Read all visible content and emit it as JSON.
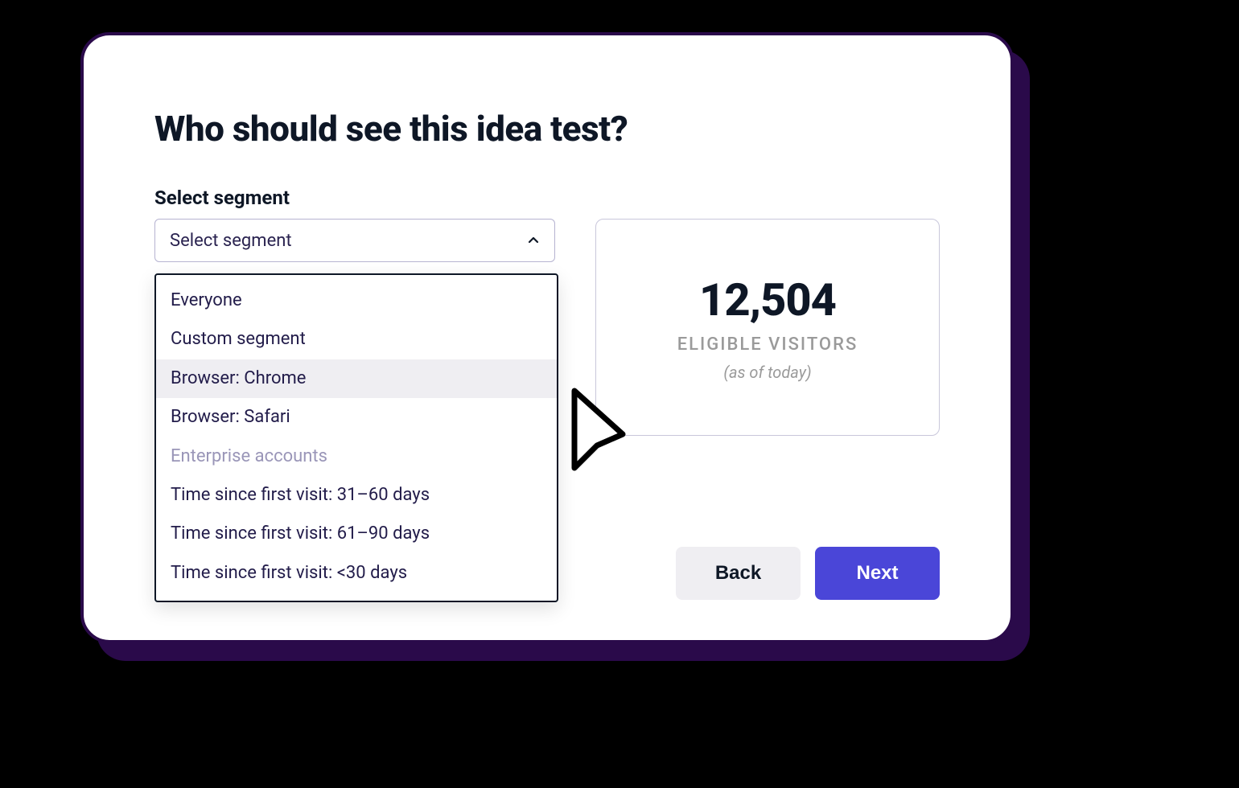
{
  "title": "Who should see this idea test?",
  "segment": {
    "label": "Select segment",
    "placeholder": "Select segment",
    "options": [
      {
        "label": "Everyone",
        "state": "normal"
      },
      {
        "label": "Custom segment",
        "state": "normal"
      },
      {
        "label": "Browser: Chrome",
        "state": "highlight"
      },
      {
        "label": "Browser: Safari",
        "state": "normal"
      },
      {
        "label": "Enterprise accounts",
        "state": "disabled"
      },
      {
        "label": "Time since first visit: 31–60 days",
        "state": "normal"
      },
      {
        "label": "Time since first visit: 61–90 days",
        "state": "normal"
      },
      {
        "label": "Time since first visit: <30 days",
        "state": "normal"
      }
    ]
  },
  "stats": {
    "value": "12,504",
    "label": "ELIGIBLE VISITORS",
    "sub": "(as of today)"
  },
  "buttons": {
    "back": "Back",
    "next": "Next"
  }
}
